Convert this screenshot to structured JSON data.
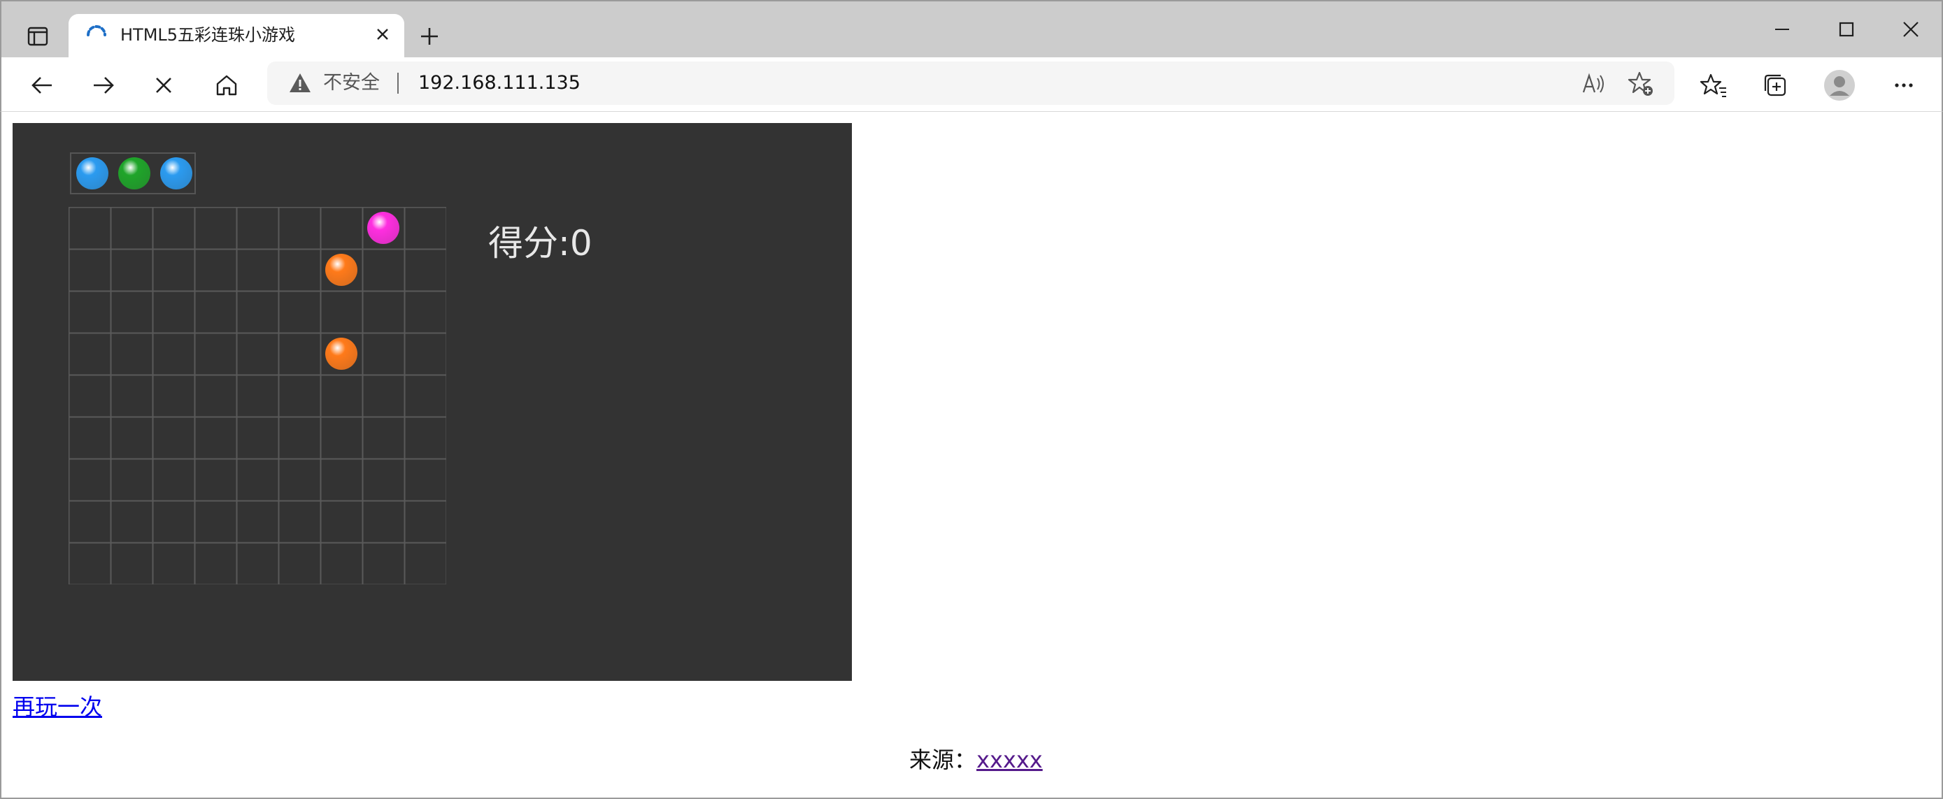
{
  "browser": {
    "tab_title": "HTML5五彩连珠小游戏",
    "security_label": "不安全",
    "url": "192.168.111.135"
  },
  "game": {
    "score_label": "得分:0",
    "grid_size": 9,
    "next_balls": [
      "blue",
      "green",
      "blue"
    ],
    "balls": [
      {
        "row": 0,
        "col": 7,
        "color": "magenta"
      },
      {
        "row": 1,
        "col": 6,
        "color": "orange"
      },
      {
        "row": 3,
        "col": 6,
        "color": "orange"
      }
    ],
    "colors": {
      "blue": "#2b9bf0",
      "green": "#1fa52a",
      "magenta": "#ff2ee0",
      "orange": "#ff7a1a",
      "background": "#333333",
      "grid_line": "#5a5a5a"
    }
  },
  "links": {
    "replay_label": "再玩一次",
    "source_prefix": "来源：",
    "source_link": "xxxxx"
  }
}
